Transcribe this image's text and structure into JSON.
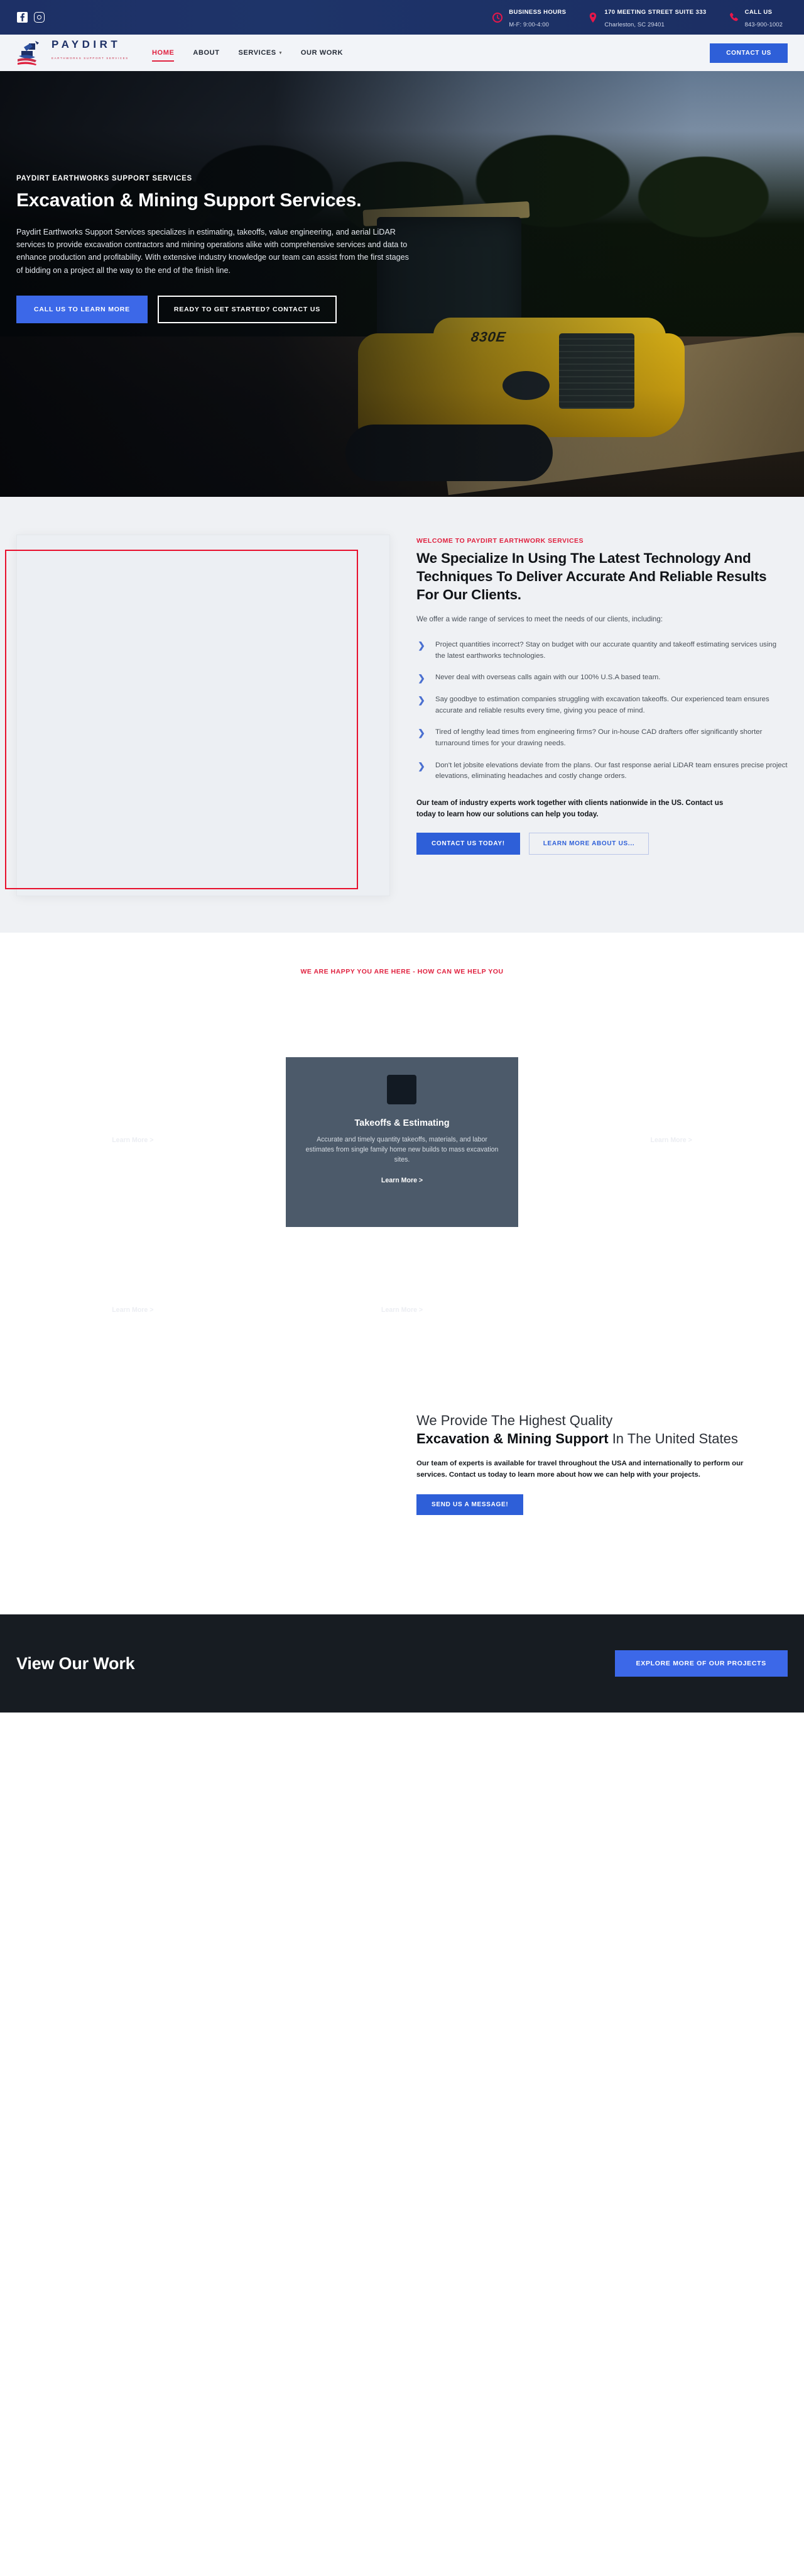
{
  "topbar": {
    "social": [
      {
        "name": "facebook-icon",
        "label": "Facebook"
      },
      {
        "name": "instagram-icon",
        "label": "Instagram"
      }
    ],
    "items": [
      {
        "icon": "clock-icon",
        "label": "BUSINESS HOURS",
        "value": "M-F: 9:00-4:00"
      },
      {
        "icon": "location-pin-icon",
        "label": "170 MEETING STREET SUITE 333",
        "value": "Charleston, SC 29401"
      },
      {
        "icon": "phone-icon",
        "label": "CALL US",
        "value": "843-900-1002"
      }
    ]
  },
  "nav": {
    "logo_word": "PAYDIRT",
    "logo_tagline": "EARTHWORKS SUPPORT SERVICES",
    "links": [
      {
        "label": "HOME",
        "active": true,
        "has_caret": false
      },
      {
        "label": "ABOUT",
        "active": false,
        "has_caret": false
      },
      {
        "label": "SERVICES",
        "active": false,
        "has_caret": true
      },
      {
        "label": "OUR WORK",
        "active": false,
        "has_caret": false
      }
    ],
    "caret_glyph": "▾",
    "cta_label": "CONTACT US"
  },
  "hero": {
    "eyebrow": "PAYDIRT EARTHWORKS SUPPORT SERVICES",
    "title": "Excavation & Mining Support Services.",
    "paragraph": "Paydirt Earthworks Support Services specializes in estimating, takeoffs, value engineering, and aerial LiDAR services to provide excavation contractors and mining operations alike with comprehensive services and data to enhance production and profitability. With extensive industry knowledge our team can assist from the first stages of bidding on a project all the way to the end of the finish line.",
    "primary_btn": "CALL US TO LEARN MORE",
    "outline_btn": "READY TO GET STARTED? CONTACT US",
    "machine_model": "830E"
  },
  "specialize": {
    "eyebrow": "WELCOME TO PAYDIRT EARTHWORK SERVICES",
    "heading": "We Specialize In Using The Latest Technology And Techniques To Deliver Accurate And Reliable Results For Our Clients.",
    "lead": "We offer a wide range of services to meet the needs of our clients, including:",
    "chevron_glyph": "❯",
    "bullets": [
      "Project quantities incorrect? Stay on budget with our accurate quantity and takeoff estimating services using the latest earthworks technologies.",
      "Never deal with overseas calls again with our 100% U.S.A based team.",
      "Say goodbye to estimation companies struggling with excavation takeoffs. Our experienced team ensures accurate and reliable results every time, giving you peace of mind.",
      "Tired of lengthy lead times from engineering firms? Our in-house CAD drafters offer significantly shorter turnaround times for your drawing needs.",
      "Don't let jobsite elevations deviate from the plans. Our fast response aerial LiDAR team ensures precise project elevations, eliminating headaches and costly change orders."
    ],
    "closing": "Our team of industry experts work together with clients nationwide in the US. Contact us today to learn how our solutions can help you today.",
    "primary_btn": "CONTACT US TODAY!",
    "ghost_btn": "LEARN MORE ABOUT US...",
    "highlight_color": "#e8102d"
  },
  "services": {
    "eyebrow": "WE ARE HAPPY YOU ARE HERE - HOW CAN WE HELP YOU",
    "cards": [
      {
        "title": "",
        "desc": "",
        "more": "Learn More >",
        "visible": false
      },
      {
        "title": "Takeoffs & Estimating",
        "desc": "Accurate and timely quantity takeoffs, materials, and labor estimates from single family home new builds to mass excavation sites.",
        "more": "Learn More >",
        "visible": true
      },
      {
        "title": "",
        "desc": "",
        "more": "Learn More >",
        "visible": false
      },
      {
        "title": "",
        "desc": "",
        "more": "Learn More >",
        "visible": false
      },
      {
        "title": "",
        "desc": "",
        "more": "Learn More >",
        "visible": false
      },
      {
        "title": "",
        "desc": "",
        "more": "",
        "visible": false
      }
    ]
  },
  "quality": {
    "line1": "We Provide The Highest Quality",
    "bold": "Excavation & Mining Support",
    "line2_tail": " In The United States",
    "paragraph": "Our team of experts is available for travel throughout the USA and internationally to perform our services. Contact us today to learn more about how we can help with your projects.",
    "cta_label": "SEND US A MESSAGE!"
  },
  "work": {
    "title": "View Our Work",
    "cta_label": "EXPLORE MORE OF OUR PROJECTS"
  },
  "colors": {
    "navy": "#1d3066",
    "red": "#e0213f",
    "blue": "#2e5fd8",
    "bright_blue": "#3c68e8",
    "dark": "#171c22"
  }
}
